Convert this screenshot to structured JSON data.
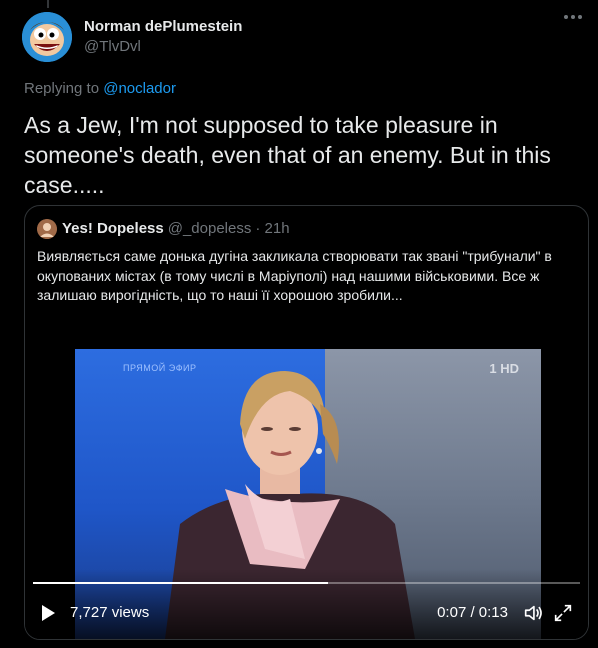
{
  "tweet": {
    "author": {
      "display_name": "Norman dePlumestein",
      "handle": "@TlvDvl"
    },
    "replying_prefix": "Replying to",
    "replying_to": "@noclador",
    "text": "As a Jew, I'm not supposed to take pleasure in someone's death, even that of an enemy. But in this case....."
  },
  "quote": {
    "author": {
      "display_name": "Yes! Dopeless",
      "handle": "@_dopeless",
      "time": "· 21h"
    },
    "text": "Виявляється саме донька дугіна закликала створювати так звані \"трибунали\" в окупованих містах (в тому числі в Маріуполі) над нашими військовими. Все ж залишаю вирогідність, що то наші її хорошою зробили...",
    "video": {
      "overlay_label": "ПРЯМОЙ ЭФИР",
      "channel_logo": "1 HD",
      "views": "7,727 views",
      "time": "0:07 / 0:13",
      "progress": 0.54
    }
  },
  "icons": {
    "more": "more-horizontal-icon",
    "play": "play-icon",
    "volume": "volume-icon",
    "fullscreen": "fullscreen-icon"
  },
  "colors": {
    "background": "#000000",
    "text_primary": "#e7e9ea",
    "text_secondary": "#71767b",
    "accent": "#1d9bf0",
    "border": "#2f3336"
  }
}
